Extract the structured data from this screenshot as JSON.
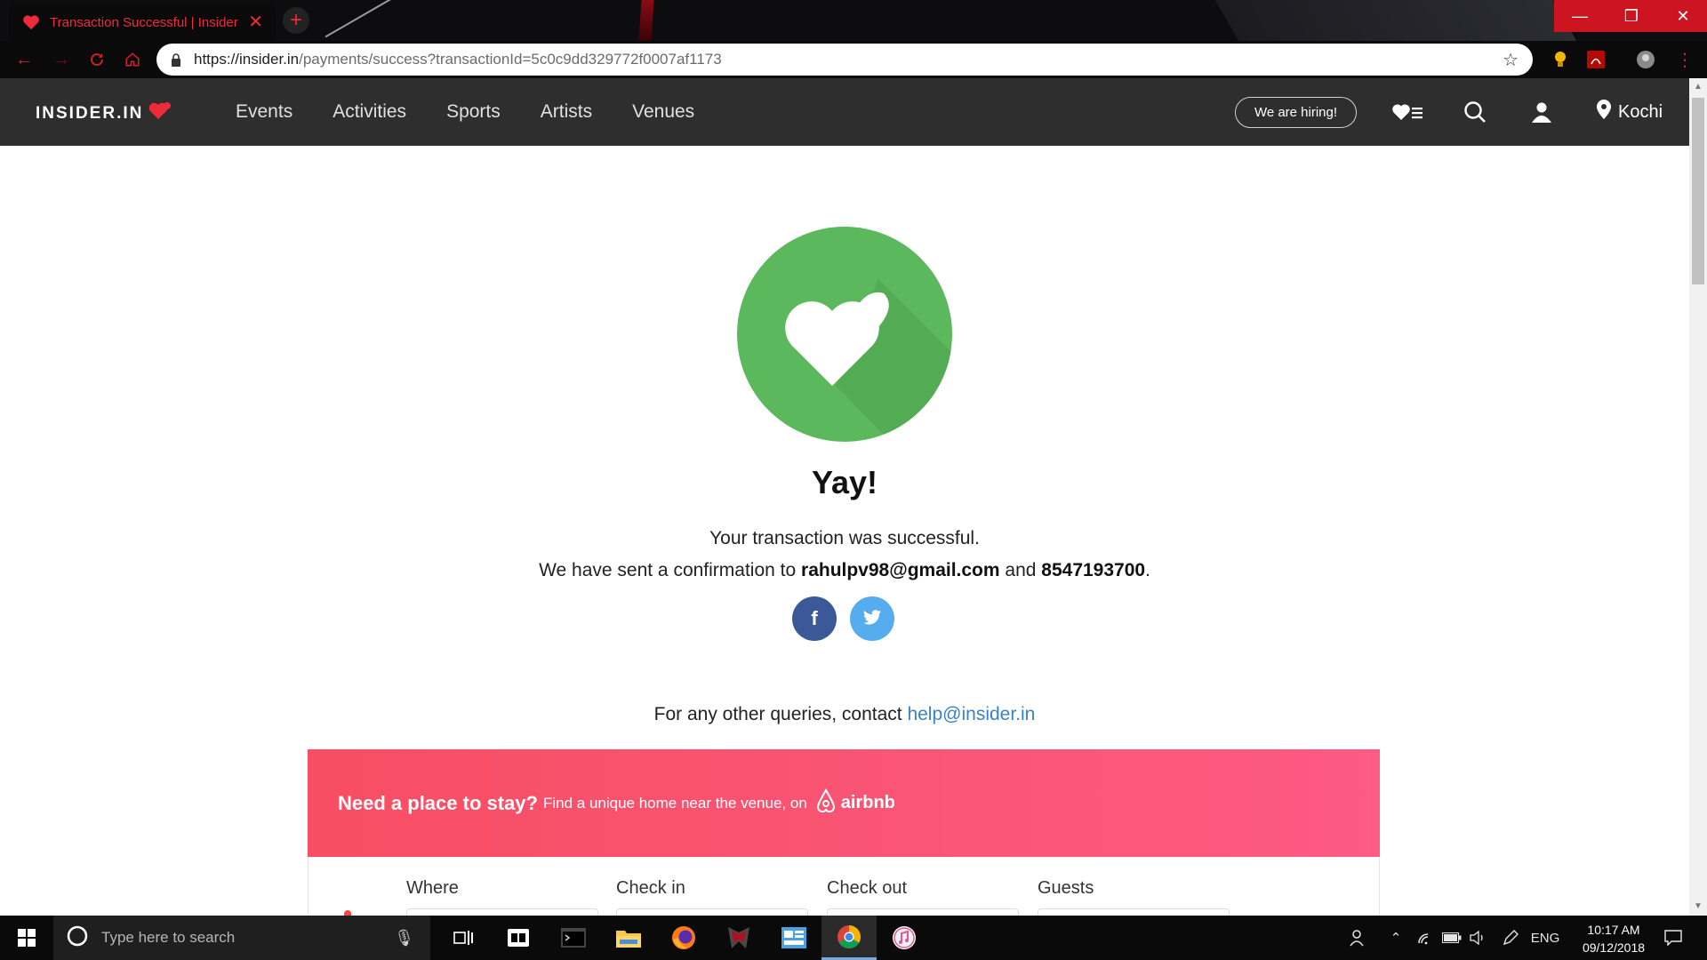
{
  "browser": {
    "tab_title": "Transaction Successful | Insider",
    "url_host": "https://insider.in",
    "url_path": "/payments/success?transactionId=5c0c9dd329772f0007af1173",
    "window_controls": {
      "minimize": "—",
      "restore": "❐",
      "close": "✕"
    }
  },
  "site": {
    "logo_text": "INSIDER.IN",
    "nav": [
      "Events",
      "Activities",
      "Sports",
      "Artists",
      "Venues"
    ],
    "hiring_label": "We are hiring!",
    "city": "Kochi"
  },
  "success": {
    "heading": "Yay!",
    "message": "Your transaction was successful.",
    "confirm_prefix": "We have sent a confirmation to ",
    "email": "rahulpv98@gmail.com",
    "and_text": " and ",
    "phone": "8547193700",
    "end_punct": ".",
    "share": {
      "facebook": "f",
      "twitter": "t"
    },
    "queries_text": "For any other queries, contact ",
    "help_email": "help@insider.in"
  },
  "airbnb": {
    "headline": "Need a place to stay?",
    "subtext": "Find a unique home near the venue, on",
    "brand": "airbnb",
    "fields": [
      "Where",
      "Check in",
      "Check out",
      "Guests"
    ]
  },
  "taskbar": {
    "search_placeholder": "Type here to search",
    "language": "ENG",
    "time": "10:17 AM",
    "date": "09/12/2018"
  },
  "colors": {
    "accent_red": "#ef2b3a",
    "success_green": "#5cb85c",
    "header_bg": "#2e2e2e",
    "airbnb_start": "#f84e63",
    "airbnb_end": "#fd5a84",
    "facebook": "#3b5998",
    "twitter": "#55acee",
    "link_blue": "#3a82c8"
  }
}
